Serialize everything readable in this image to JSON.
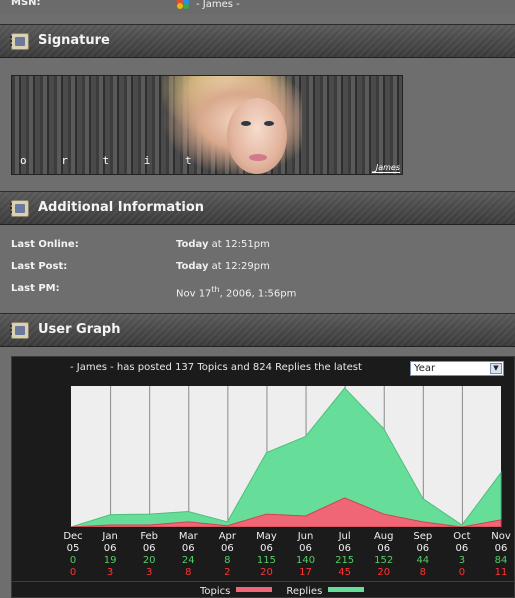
{
  "contact": {
    "msn_label": "MSN:",
    "msn_value": "- James -",
    "msn_icon": "msn-butterfly-icon"
  },
  "sections": {
    "signature": "Signature",
    "additional": "Additional Information",
    "graph": "User Graph"
  },
  "signature_image": {
    "glyphs": "o r t i t",
    "name": "_James"
  },
  "info": {
    "last_online_label": "Last Online:",
    "last_online_day": "Today",
    "last_online_time": "at 12:51pm",
    "last_post_label": "Last Post:",
    "last_post_day": "Today",
    "last_post_time": "at 12:29pm",
    "last_pm_label": "Last PM:",
    "last_pm_pre": "Nov 17",
    "last_pm_sup": "th",
    "last_pm_post": ", 2006, 1:56pm"
  },
  "graph": {
    "caption": "- James - has posted 137 Topics and 824 Replies the latest",
    "period": "Year",
    "legend_topics": "Topics",
    "legend_replies": "Replies"
  },
  "colors": {
    "topics": "#ee6677",
    "replies": "#66dd99",
    "plot_bg": "#eeeeee",
    "replies_text": "#55cc66",
    "topics_text": "#ff3333"
  },
  "chart_data": {
    "type": "area",
    "categories": [
      "Dec 05",
      "Jan 06",
      "Feb 06",
      "Mar 06",
      "Apr 06",
      "May 06",
      "Jun 06",
      "Jul 06",
      "Aug 06",
      "Sep 06",
      "Oct 06",
      "Nov 06"
    ],
    "series": [
      {
        "name": "Replies",
        "values": [
          0,
          19,
          20,
          24,
          8,
          115,
          140,
          215,
          152,
          44,
          3,
          84
        ]
      },
      {
        "name": "Topics",
        "values": [
          0,
          3,
          3,
          8,
          2,
          20,
          17,
          45,
          20,
          8,
          0,
          11
        ]
      }
    ],
    "grid": true
  }
}
